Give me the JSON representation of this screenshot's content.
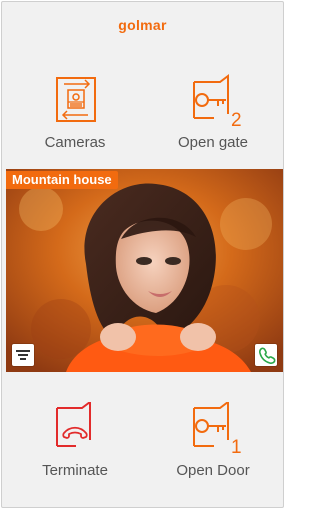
{
  "brand": {
    "logo_text": "golmar"
  },
  "actions": {
    "cameras": {
      "label": "Cameras",
      "icon": "camera-switch-icon"
    },
    "open_gate": {
      "label": "Open gate",
      "number": "2",
      "icon": "key-gate-icon"
    },
    "terminate": {
      "label": "Terminate",
      "icon": "hangup-phone-icon"
    },
    "open_door": {
      "label": "Open Door",
      "number": "1",
      "icon": "key-door-icon"
    }
  },
  "video": {
    "title": "Mountain house",
    "menu_icon": "filter-menu-icon",
    "call_icon": "phone-icon"
  },
  "colors": {
    "accent": "#f26b0f",
    "hangup": "#e22b2b",
    "background": "#f1f1f1"
  }
}
